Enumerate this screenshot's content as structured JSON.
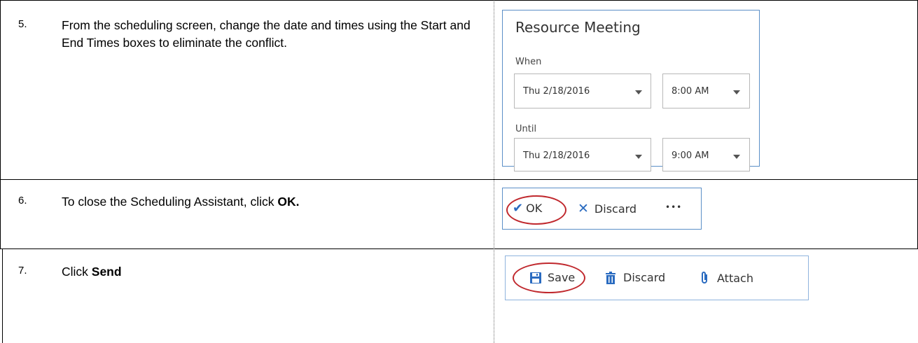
{
  "steps": [
    {
      "number": "5.",
      "text": "From the scheduling screen, change the date and times using the Start and End Times boxes to eliminate the conflict."
    },
    {
      "number": "6.",
      "text_before": "To close the Scheduling Assistant, click ",
      "text_bold": "OK."
    },
    {
      "number": "7.",
      "text_before": "Click ",
      "text_bold": "Send"
    }
  ],
  "meeting_panel": {
    "title": "Resource Meeting",
    "when_label": "When",
    "when_date": "Thu 2/18/2016",
    "when_time": "8:00 AM",
    "until_label": "Until",
    "until_date": "Thu 2/18/2016",
    "until_time": "9:00 AM"
  },
  "scheduling_toolbar": {
    "ok_label": "OK",
    "discard_label": "Discard",
    "more_label": "•••"
  },
  "compose_toolbar": {
    "save_label": "Save",
    "discard_label": "Discard",
    "attach_label": "Attach"
  },
  "colors": {
    "accent_blue": "#2a6bc0",
    "highlight_red": "#c0282d",
    "panel_border": "#5b8fc7"
  }
}
